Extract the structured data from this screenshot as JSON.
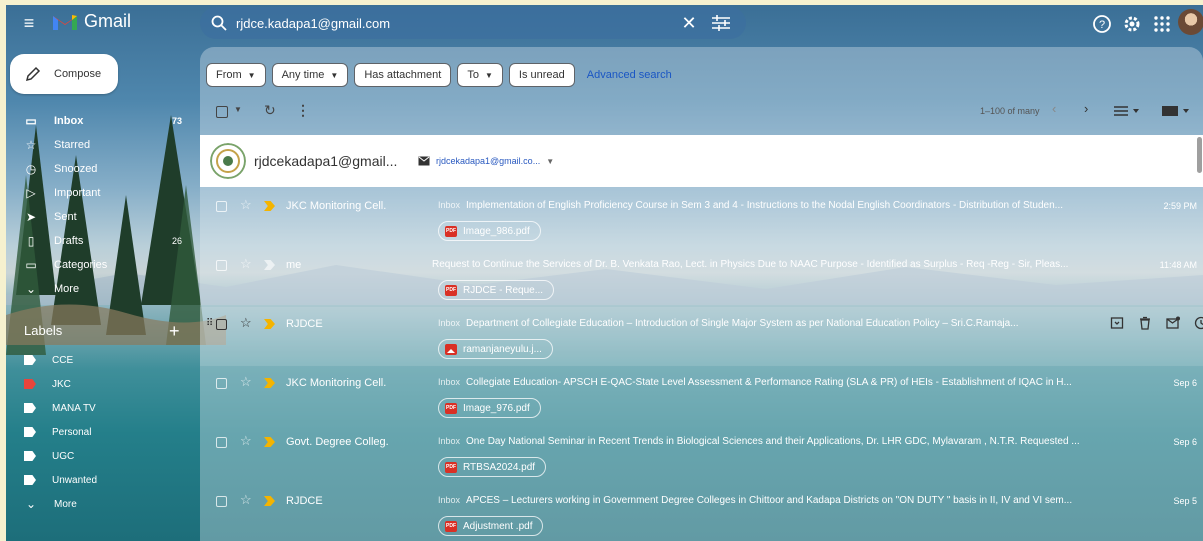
{
  "header": {
    "app_name": "Gmail",
    "search_value": "rjdce.kadapa1@gmail.com",
    "clear_icon": "close-icon",
    "search_options_icon": "tune-icon",
    "help_icon": "help-icon",
    "settings_icon": "gear-icon",
    "apps_icon": "apps-grid-icon"
  },
  "sidebar": {
    "compose_label": "Compose",
    "items": [
      {
        "label": "Inbox",
        "count": "73",
        "icon": "inbox-icon",
        "glyph": "▭"
      },
      {
        "label": "Starred",
        "count": "",
        "icon": "star-icon",
        "glyph": "☆"
      },
      {
        "label": "Snoozed",
        "count": "",
        "icon": "clock-icon",
        "glyph": "◷"
      },
      {
        "label": "Important",
        "count": "",
        "icon": "important-icon",
        "glyph": "▷"
      },
      {
        "label": "Sent",
        "count": "",
        "icon": "send-icon",
        "glyph": "➤"
      },
      {
        "label": "Drafts",
        "count": "26",
        "icon": "draft-icon",
        "glyph": "▯"
      },
      {
        "label": "Categories",
        "count": "",
        "icon": "label-icon",
        "glyph": "▭"
      },
      {
        "label": "More",
        "count": "",
        "icon": "chevron-down-icon",
        "glyph": "⌄"
      }
    ],
    "labels_title": "Labels",
    "labels_add": "+",
    "labels": [
      {
        "label": "CCE",
        "color": "#ffffff"
      },
      {
        "label": "JKC",
        "color": "#e8453c"
      },
      {
        "label": "MANA TV",
        "color": "#ffffff"
      },
      {
        "label": "Personal",
        "color": "#ffffff"
      },
      {
        "label": "UGC",
        "color": "#ffffff"
      },
      {
        "label": "Unwanted",
        "color": "#ffffff"
      },
      {
        "label": "More",
        "color": ""
      }
    ]
  },
  "filters": {
    "chips": [
      {
        "label": "From",
        "caret": "▼"
      },
      {
        "label": "Any time",
        "caret": "▼"
      },
      {
        "label": "Has attachment",
        "caret": ""
      },
      {
        "label": "To",
        "caret": "▼"
      },
      {
        "label": "Is unread",
        "caret": ""
      }
    ],
    "advanced_search": "Advanced search"
  },
  "toolbar": {
    "pagination": "1–100 of many"
  },
  "contact": {
    "name": "rjdcekadapa1@gmail...",
    "email": "rjdcekadapa1@gmail.co..."
  },
  "emails": [
    {
      "sender": "JKC Monitoring Cell.",
      "badge": "Inbox",
      "subject": "Implementation of English Proficiency Course in Sem 3 and 4 - Instructions to the Nodal English Coordinators - Distribution of Studen...",
      "date": "2:59 PM",
      "attachment": "Image_986.pdf",
      "attach_type": "pdf",
      "important": true
    },
    {
      "sender": "me",
      "badge": "",
      "subject": "Request to Continue the Services of Dr. B. Venkata Rao, Lect. in Physics Due to NAAC Purpose - Identified as Surplus - Req -Reg - Sir, Pleas...",
      "date": "11:48 AM",
      "attachment": "RJDCE - Reque...",
      "attach_type": "pdf",
      "important": false
    },
    {
      "sender": "RJDCE",
      "badge": "Inbox",
      "subject": "Department of Collegiate Education – Introduction of Single Major System as per National Education Policy – Sri.C.Ramaja...",
      "date": "",
      "attachment": "ramanjaneyulu.j...",
      "attach_type": "image",
      "important": true
    },
    {
      "sender": "JKC Monitoring Cell.",
      "badge": "Inbox",
      "subject": "Collegiate Education- APSCH E-QAC-State Level Assessment & Performance Rating (SLA & PR) of HEIs - Establishment of IQAC in H...",
      "date": "Sep 6",
      "attachment": "Image_976.pdf",
      "attach_type": "pdf",
      "important": true
    },
    {
      "sender": "Govt. Degree Colleg.",
      "badge": "Inbox",
      "subject": "One Day National Seminar in Recent Trends in Biological Sciences and their Applications, Dr. LHR GDC, Mylavaram , N.T.R. Requested ...",
      "date": "Sep 6",
      "attachment": "RTBSA2024.pdf",
      "attach_type": "pdf",
      "important": true
    },
    {
      "sender": "RJDCE",
      "badge": "Inbox",
      "subject": "APCES – Lecturers working in Government Degree Colleges in Chittoor and Kadapa Districts on \"ON DUTY \" basis in II, IV and VI sem...",
      "date": "Sep 5",
      "attachment": "Adjustment .pdf",
      "attach_type": "pdf",
      "important": true
    }
  ],
  "colors": {
    "important_marker": "#f4b400",
    "pdf_red": "#d93025",
    "link_blue": "#1a56c4"
  }
}
